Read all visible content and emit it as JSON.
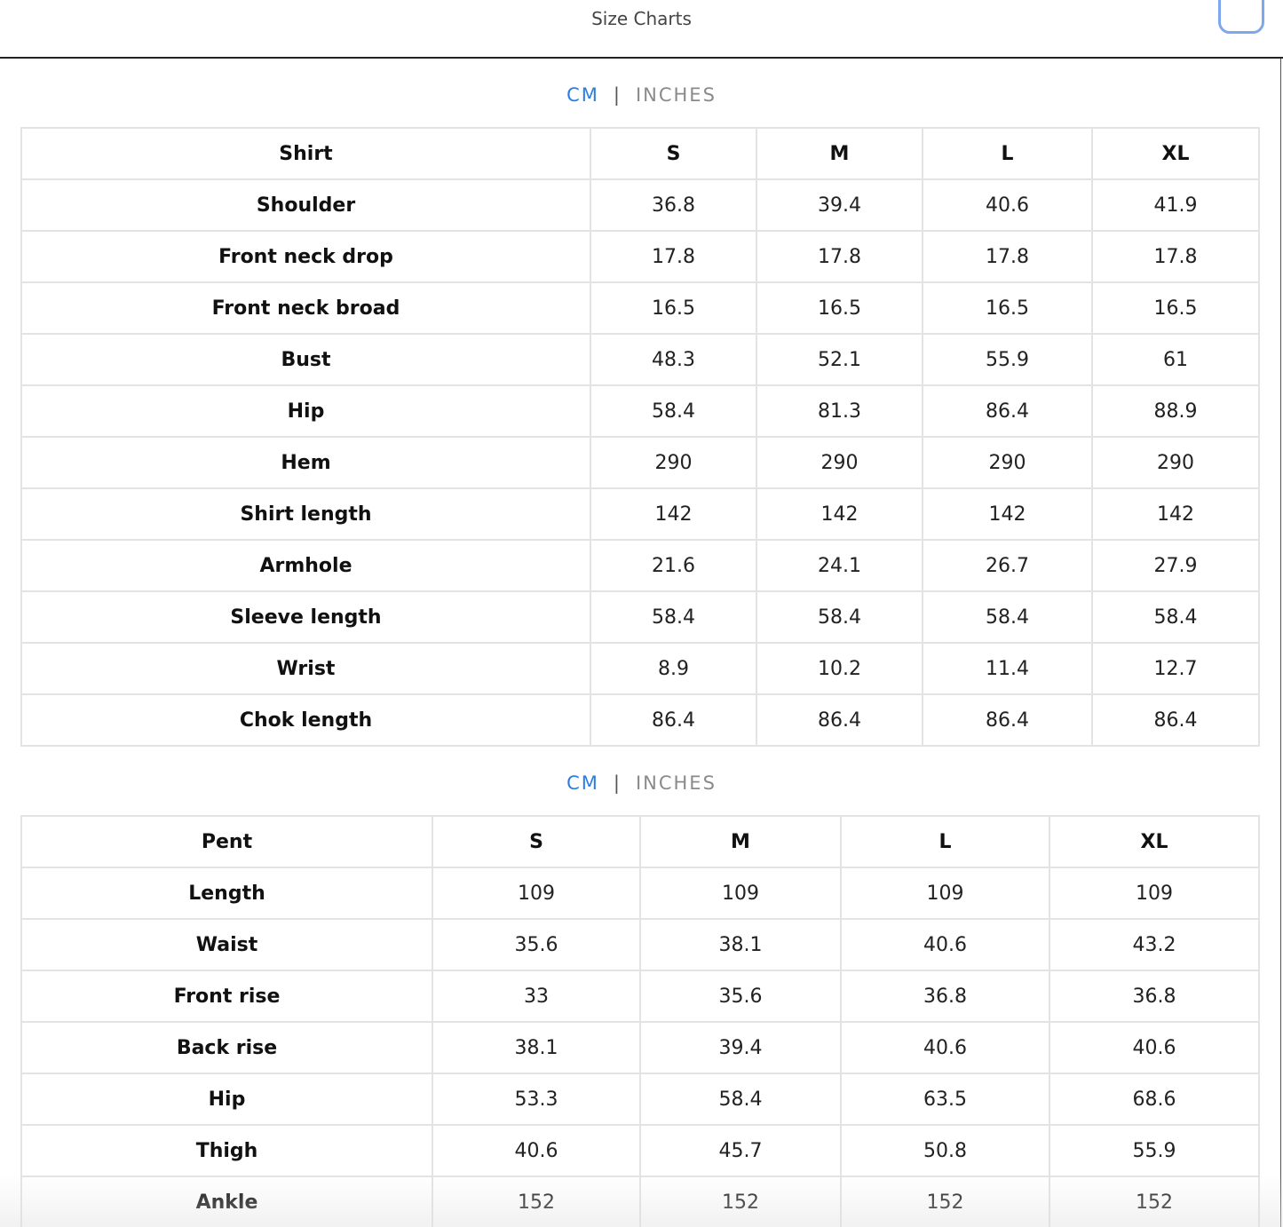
{
  "header": {
    "title": "Size Charts"
  },
  "unit_toggle": {
    "cm": "CM",
    "separator": "|",
    "inches": "INCHES"
  },
  "shirt": {
    "columns": [
      "Shirt",
      "S",
      "M",
      "L",
      "XL"
    ],
    "rows": [
      {
        "label": "Shoulder",
        "values": [
          "36.8",
          "39.4",
          "40.6",
          "41.9"
        ]
      },
      {
        "label": "Front neck drop",
        "values": [
          "17.8",
          "17.8",
          "17.8",
          "17.8"
        ]
      },
      {
        "label": "Front neck broad",
        "values": [
          "16.5",
          "16.5",
          "16.5",
          "16.5"
        ]
      },
      {
        "label": "Bust",
        "values": [
          "48.3",
          "52.1",
          "55.9",
          "61"
        ]
      },
      {
        "label": "Hip",
        "values": [
          "58.4",
          "81.3",
          "86.4",
          "88.9"
        ]
      },
      {
        "label": "Hem",
        "values": [
          "290",
          "290",
          "290",
          "290"
        ]
      },
      {
        "label": "Shirt length",
        "values": [
          "142",
          "142",
          "142",
          "142"
        ]
      },
      {
        "label": "Armhole",
        "values": [
          "21.6",
          "24.1",
          "26.7",
          "27.9"
        ]
      },
      {
        "label": "Sleeve length",
        "values": [
          "58.4",
          "58.4",
          "58.4",
          "58.4"
        ]
      },
      {
        "label": "Wrist",
        "values": [
          "8.9",
          "10.2",
          "11.4",
          "12.7"
        ]
      },
      {
        "label": "Chok length",
        "values": [
          "86.4",
          "86.4",
          "86.4",
          "86.4"
        ]
      }
    ]
  },
  "pent": {
    "columns": [
      "Pent",
      "S",
      "M",
      "L",
      "XL"
    ],
    "rows": [
      {
        "label": "Length",
        "values": [
          "109",
          "109",
          "109",
          "109"
        ]
      },
      {
        "label": "Waist",
        "values": [
          "35.6",
          "38.1",
          "40.6",
          "43.2"
        ]
      },
      {
        "label": "Front rise",
        "values": [
          "33",
          "35.6",
          "36.8",
          "36.8"
        ]
      },
      {
        "label": "Back rise",
        "values": [
          "38.1",
          "39.4",
          "40.6",
          "40.6"
        ]
      },
      {
        "label": "Hip",
        "values": [
          "53.3",
          "58.4",
          "63.5",
          "68.6"
        ]
      },
      {
        "label": "Thigh",
        "values": [
          "40.6",
          "45.7",
          "50.8",
          "55.9"
        ]
      },
      {
        "label": "Ankle",
        "values": [
          "152",
          "152",
          "152",
          "152"
        ]
      }
    ]
  },
  "colors": {
    "accent": "#2a7de1",
    "muted": "#8a8a8a",
    "border": "#e3e3e3",
    "close_outline": "#7fa7ee"
  }
}
